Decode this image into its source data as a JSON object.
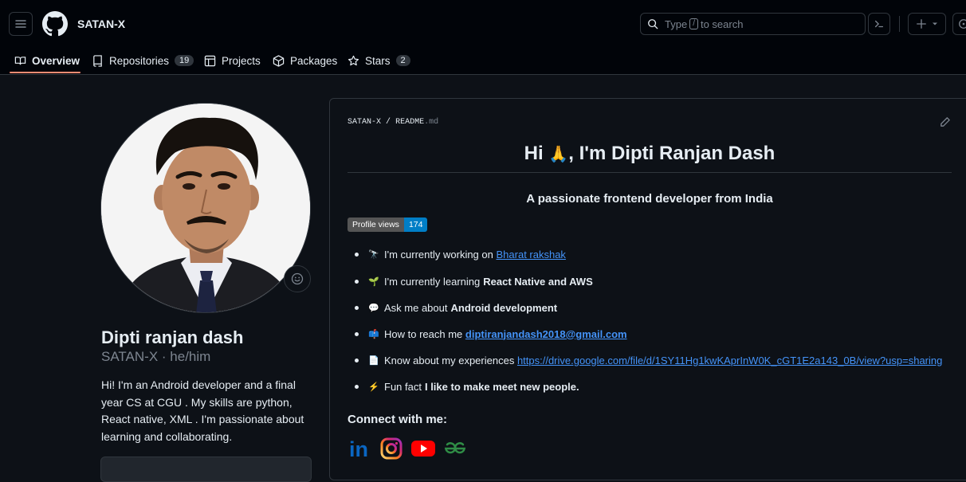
{
  "header": {
    "owner": "SATAN-X",
    "search": {
      "pre": "Type",
      "key": "/",
      "post": "to search"
    }
  },
  "tabs": [
    {
      "label": "Overview",
      "icon": "book-icon"
    },
    {
      "label": "Repositories",
      "count": "19",
      "icon": "repo-icon"
    },
    {
      "label": "Projects",
      "icon": "table-icon"
    },
    {
      "label": "Packages",
      "icon": "package-icon"
    },
    {
      "label": "Stars",
      "count": "2",
      "icon": "star-icon"
    }
  ],
  "profile": {
    "name": "Dipti ranjan dash",
    "username": "SATAN-X",
    "pronouns": "he/him",
    "separator": "·",
    "bio": "Hi! I'm an Android developer and a final year CS at CGU . My skills are python, React native, XML . I'm passionate about learning and collaborating."
  },
  "readme": {
    "path_owner": "SATAN-X",
    "path_sep": "/",
    "path_file": "README",
    "path_ext": ".md",
    "title_pre": "Hi",
    "title_emoji": "🙏",
    "title_post": ", I'm Dipti Ranjan Dash",
    "subtitle": "A passionate frontend developer from India",
    "badge_label": "Profile views",
    "badge_value": "174",
    "items": [
      {
        "emoji": "🔭",
        "text": "I'm currently working on",
        "link": "Bharat rakshak"
      },
      {
        "emoji": "🌱",
        "text": "I'm currently learning",
        "bold": "React Native and AWS"
      },
      {
        "emoji": "💬",
        "text": "Ask me about",
        "bold": "Android development"
      },
      {
        "emoji": "📫",
        "text": "How to reach me",
        "link": "diptiranjandash2018@gmail.com"
      },
      {
        "emoji": "📄",
        "text": "Know about my experiences",
        "link": "https://drive.google.com/file/d/1SY11Hg1kwKAprInW0K_cGT1E2a143_0B/view?usp=sharing"
      },
      {
        "emoji": "⚡",
        "text": "Fun fact",
        "bold": "I like to make meet new people."
      }
    ],
    "connect_title": "Connect with me:",
    "socials": [
      {
        "name": "linkedin",
        "icon": "linkedin-icon",
        "text": "in",
        "color": "#0a66c2"
      },
      {
        "name": "instagram",
        "icon": "instagram-icon",
        "color": "#e1306c"
      },
      {
        "name": "youtube",
        "icon": "youtube-icon",
        "color": "#ff0000"
      },
      {
        "name": "geeksforgeeks",
        "icon": "geeksforgeeks-icon",
        "text": "GG",
        "color": "#2f8d46"
      }
    ]
  }
}
